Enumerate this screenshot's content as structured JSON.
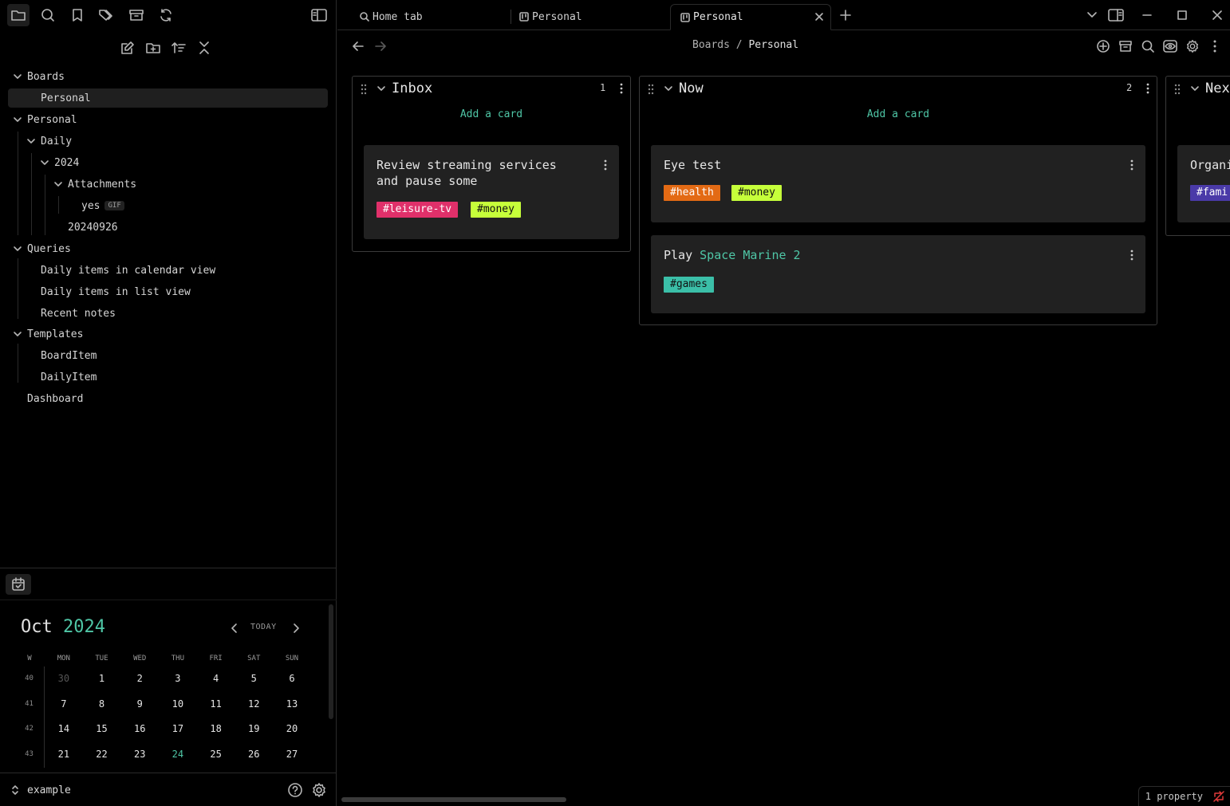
{
  "sidebar": {
    "tree": {
      "boards": "Boards",
      "boards_personal": "Personal",
      "personal": "Personal",
      "daily": "Daily",
      "year": "2024",
      "attachments": "Attachments",
      "yes": "yes",
      "gif": "GIF",
      "note_20240926": "20240926",
      "queries": "Queries",
      "q_calendar": "Daily items in calendar view",
      "q_list": "Daily items in list view",
      "q_recent": "Recent notes",
      "templates": "Templates",
      "t_boarditem": "BoardItem",
      "t_dailyitem": "DailyItem",
      "dashboard": "Dashboard"
    },
    "calendar": {
      "month": "Oct",
      "year": "2024",
      "today_label": "TODAY",
      "headers": [
        "W",
        "MON",
        "TUE",
        "WED",
        "THU",
        "FRI",
        "SAT",
        "SUN"
      ],
      "weeks": [
        {
          "wk": "40",
          "days": [
            "30",
            "1",
            "2",
            "3",
            "4",
            "5",
            "6"
          ]
        },
        {
          "wk": "41",
          "days": [
            "7",
            "8",
            "9",
            "10",
            "11",
            "12",
            "13"
          ]
        },
        {
          "wk": "42",
          "days": [
            "14",
            "15",
            "16",
            "17",
            "18",
            "19",
            "20"
          ]
        },
        {
          "wk": "43",
          "days": [
            "21",
            "22",
            "23",
            "24",
            "25",
            "26",
            "27"
          ]
        }
      ],
      "today_day": "24",
      "dim_day": "30"
    },
    "vault_name": "example"
  },
  "tabs": {
    "home": "Home tab",
    "personal_1": "Personal",
    "personal_2": "Personal"
  },
  "breadcrumb": {
    "parent": "Boards",
    "sep": "/",
    "current": "Personal"
  },
  "board": {
    "add_card": "Add a card",
    "lanes": {
      "inbox": {
        "title": "Inbox",
        "count": "1",
        "cards": [
          {
            "title_1": "Review streaming services",
            "title_2": "and pause some",
            "tags": [
              "#leisure-tv",
              "#money"
            ]
          }
        ]
      },
      "now": {
        "title": "Now",
        "count": "2",
        "cards": [
          {
            "title": "Eye test",
            "tags": [
              "#health",
              "#money"
            ]
          },
          {
            "title_prefix": "Play",
            "title_link": "Space Marine 2",
            "tags": [
              "#games"
            ]
          }
        ]
      },
      "next": {
        "title": "Next",
        "cards": [
          {
            "title": "Organi",
            "tags": [
              "#fami"
            ]
          }
        ]
      }
    }
  },
  "status_bar": {
    "properties": "1 property"
  },
  "colors": {
    "accent": "#4fc6a6",
    "tag_leisure": "#e0306a",
    "tag_money": "#c6ff3a",
    "tag_health": "#e36a14",
    "tag_games": "#3bbfa8",
    "tag_family": "#4a3aa8",
    "sync_error": "#e03a3a"
  }
}
